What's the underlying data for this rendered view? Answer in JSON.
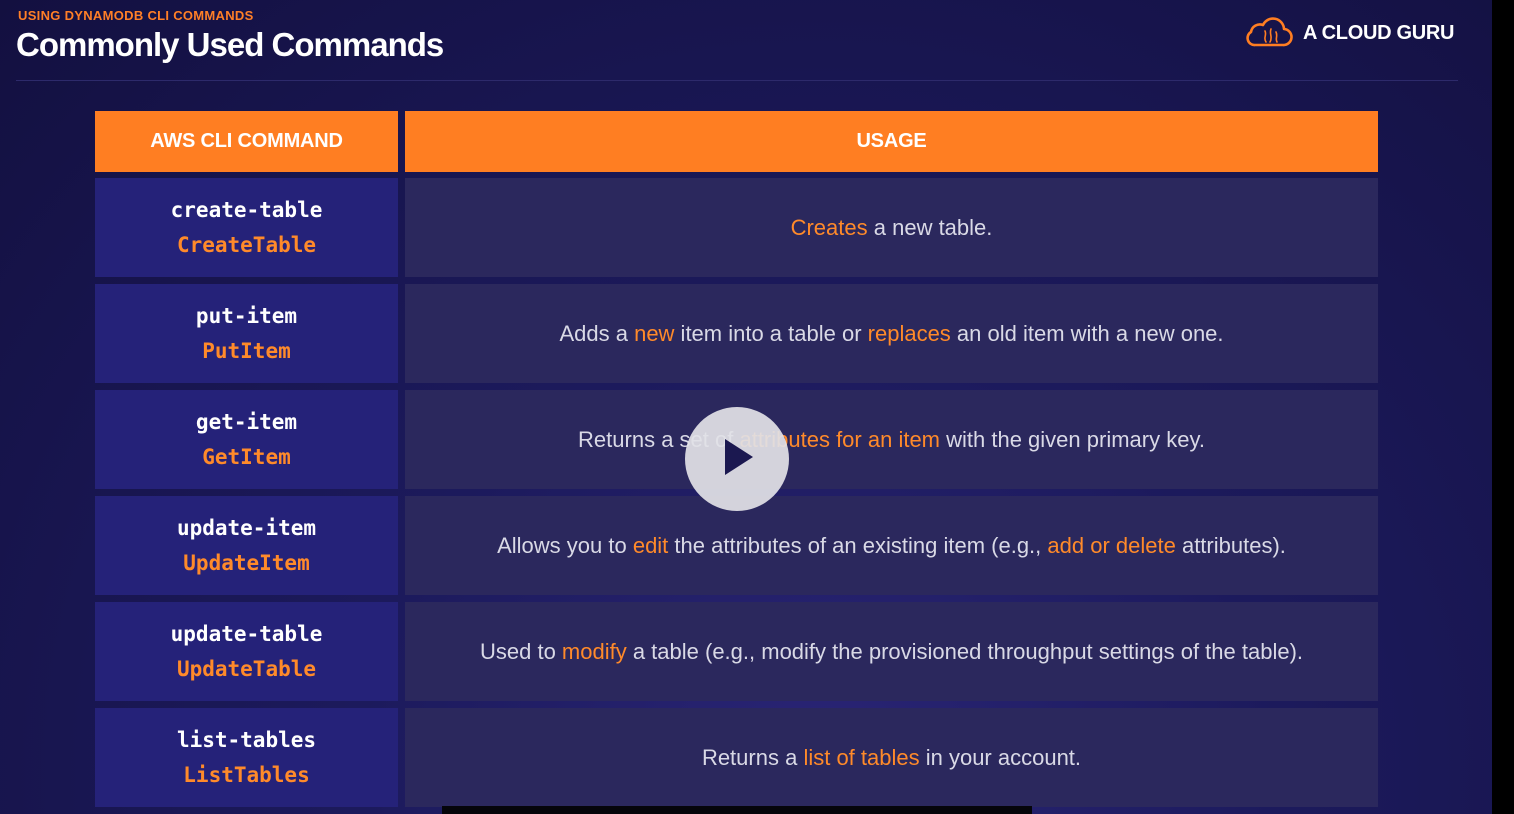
{
  "header": {
    "kicker": "USING DYNAMODB CLI COMMANDS",
    "title": "Commonly Used Commands",
    "logo_text": "A CLOUD GURU",
    "logo_icon": "cloud-brain-icon"
  },
  "table": {
    "columns": [
      "AWS CLI COMMAND",
      "USAGE"
    ],
    "rows": [
      {
        "cli": "create-table",
        "api": "CreateTable",
        "usage": [
          {
            "t": "Creates",
            "hl": true
          },
          {
            "t": " a new table.",
            "hl": false
          }
        ]
      },
      {
        "cli": "put-item",
        "api": "PutItem",
        "usage": [
          {
            "t": "Adds a ",
            "hl": false
          },
          {
            "t": "new",
            "hl": true
          },
          {
            "t": " item into a table or ",
            "hl": false
          },
          {
            "t": "replaces",
            "hl": true
          },
          {
            "t": " an old item with a new one.",
            "hl": false
          }
        ]
      },
      {
        "cli": "get-item",
        "api": "GetItem",
        "usage": [
          {
            "t": "Returns a set of ",
            "hl": false
          },
          {
            "t": "attributes for an item",
            "hl": true
          },
          {
            "t": " with the given primary key.",
            "hl": false
          }
        ]
      },
      {
        "cli": "update-item",
        "api": "UpdateItem",
        "usage": [
          {
            "t": "Allows you to ",
            "hl": false
          },
          {
            "t": "edit",
            "hl": true
          },
          {
            "t": " the attributes of an existing item (e.g., ",
            "hl": false
          },
          {
            "t": "add or delete",
            "hl": true
          },
          {
            "t": " attributes).",
            "hl": false
          }
        ]
      },
      {
        "cli": "update-table",
        "api": "UpdateTable",
        "usage": [
          {
            "t": "Used to ",
            "hl": false
          },
          {
            "t": "modify",
            "hl": true
          },
          {
            "t": " a table (e.g., modify the provisioned throughput settings of the table).",
            "hl": false
          }
        ]
      },
      {
        "cli": "list-tables",
        "api": "ListTables",
        "usage": [
          {
            "t": "Returns a ",
            "hl": false
          },
          {
            "t": "list of tables",
            "hl": true
          },
          {
            "t": " in your account.",
            "hl": false
          }
        ]
      }
    ]
  },
  "player": {
    "play_icon": "play-icon"
  },
  "colors": {
    "accent": "#ff7e22",
    "background": "#1c1a5c",
    "command_cell": "#252279",
    "usage_cell": "#2b285d"
  }
}
